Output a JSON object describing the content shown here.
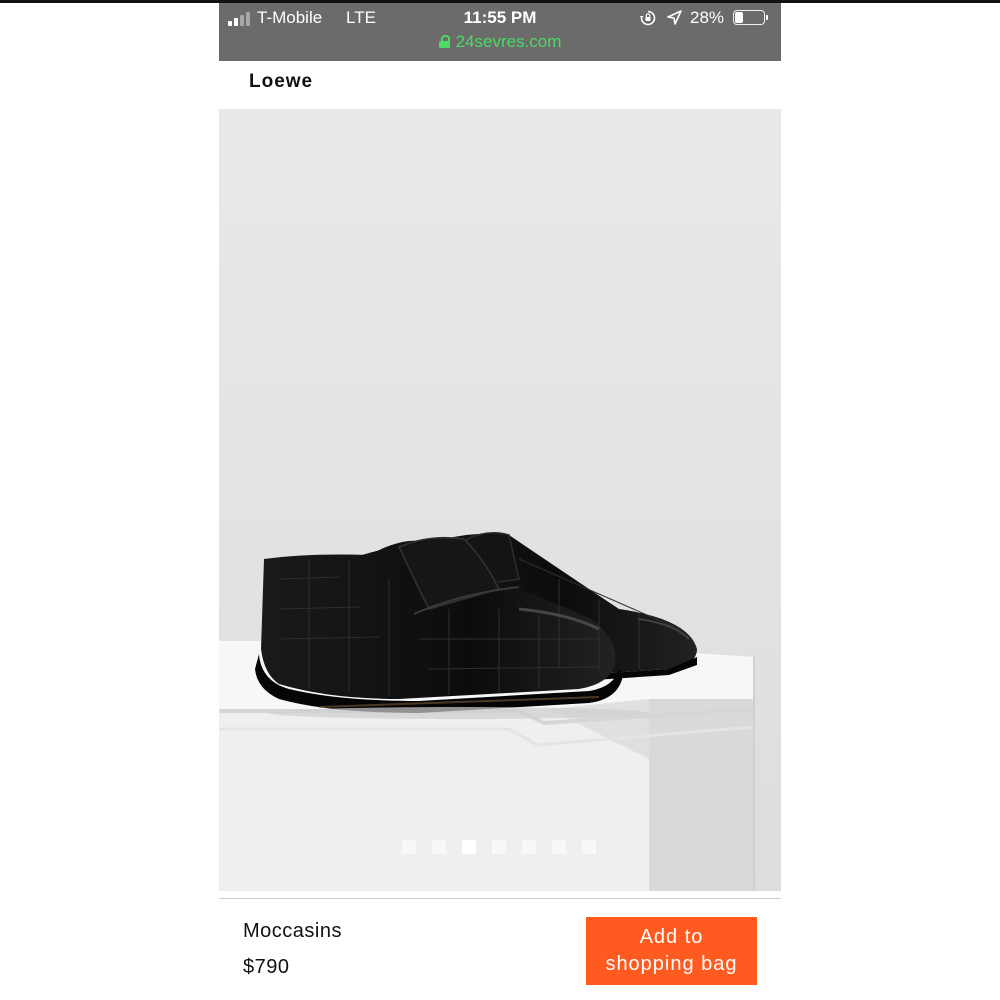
{
  "status_bar": {
    "carrier": "T-Mobile",
    "network": "LTE",
    "time": "11:55 PM",
    "battery_percent_label": "28%",
    "battery_level": 0.28,
    "signal_bars_filled": 2,
    "signal_bars_total": 4
  },
  "browser": {
    "url": "24sevres.com",
    "secure": true
  },
  "header": {
    "brand": "Loewe"
  },
  "gallery": {
    "image": "black-croc-embossed-loafers",
    "slide_count": 7,
    "active_index": 2
  },
  "product": {
    "name": "Moccasins",
    "price": "$790"
  },
  "cta": {
    "line1": "Add to",
    "line2": "shopping bag",
    "color": "#ff5a1f"
  },
  "colors": {
    "status_bar_bg": "#6b6b6b",
    "url_green": "#4cd964",
    "image_bg": "#e6e6e6"
  }
}
